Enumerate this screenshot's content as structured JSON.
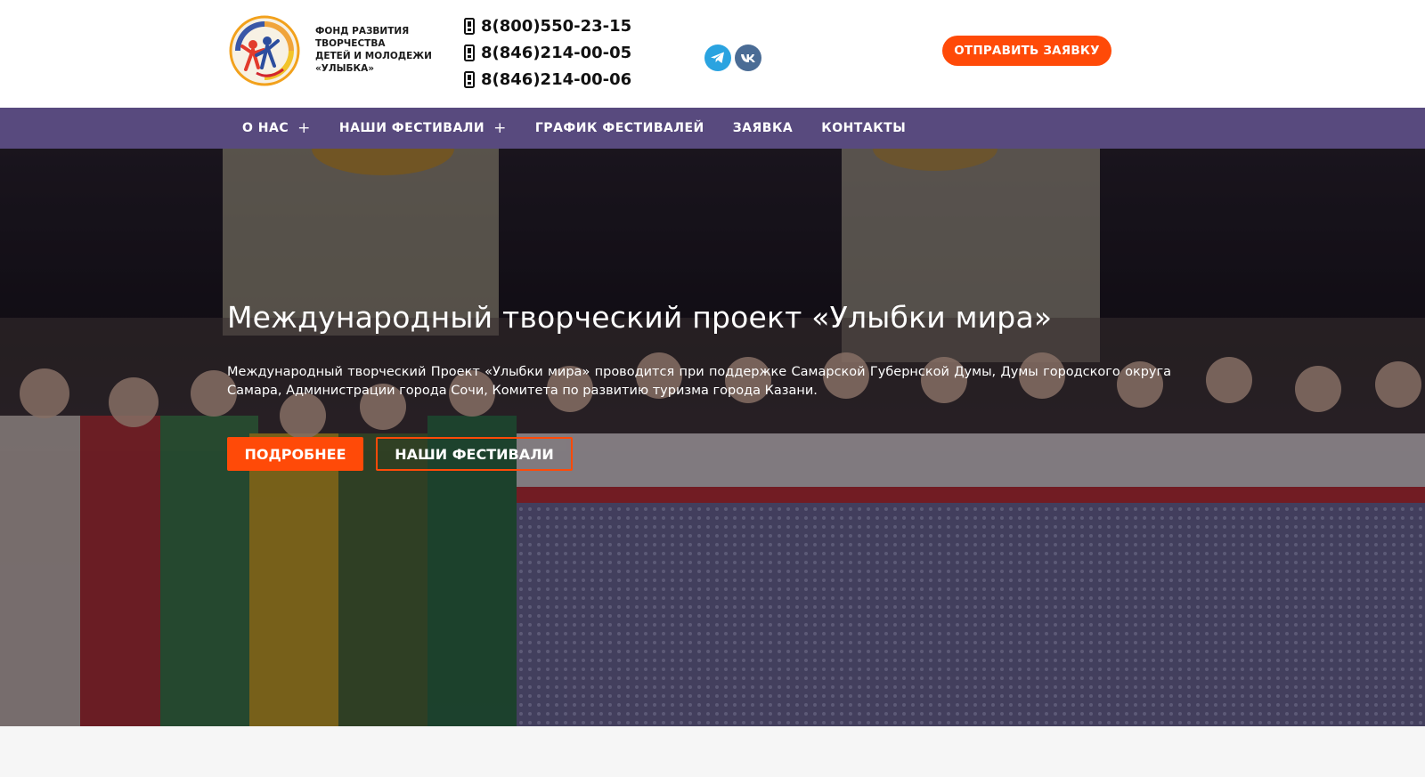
{
  "brand": {
    "name_lines": [
      "ФОНД РАЗВИТИЯ",
      "ТВОРЧЕСТВА",
      "ДЕТЕЙ И МОЛОДЕЖИ",
      "«УЛЫБКА»"
    ],
    "logo_icon": "ulybka-logo-emblem"
  },
  "contacts": {
    "phones": [
      "8(800)550-23-15",
      "8(846)214-00-05",
      "8(846)214-00-06"
    ],
    "phone_icon": "mobile-phone-icon"
  },
  "social": {
    "telegram_icon": "telegram-icon",
    "vk_icon": "vk-icon",
    "telegram_color": "#2aa3e0",
    "vk_color": "#4a6c95"
  },
  "header": {
    "apply_button": "ОТПРАВИТЬ ЗАЯВКУ"
  },
  "nav": {
    "items": [
      {
        "label": "О НАС",
        "has_submenu": true
      },
      {
        "label": "НАШИ ФЕСТИВАЛИ",
        "has_submenu": true
      },
      {
        "label": "ГРАФИК ФЕСТИВАЛЕЙ",
        "has_submenu": false
      },
      {
        "label": "ЗАЯВКА",
        "has_submenu": false
      },
      {
        "label": "КОНТАКТЫ",
        "has_submenu": false
      }
    ],
    "submenu_mark": "+"
  },
  "hero": {
    "title": "Международный творческий проект «Улыбки мира»",
    "description": "Международный творческий Проект «Улыбки мира» проводится при поддержке Самарской Губернской Думы, Думы городского округа Самара, Администрации города Сочи, Комитета по развитию туризма города Казани.",
    "more_button": "ПОДРОБНЕЕ",
    "festivals_button": "НАШИ ФЕСТИВАЛИ"
  },
  "colors": {
    "accent": "#ff4a08",
    "nav_background": "#584a7e",
    "header_background": "#ffffff"
  }
}
